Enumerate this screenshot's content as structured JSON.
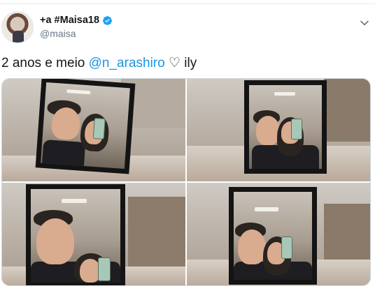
{
  "tweet": {
    "display_name": "+a #Maisa18",
    "handle": "@maisa",
    "verified": true,
    "text_before": "2 anos e meio ",
    "mention": "@n_arashiro",
    "text_after": " ♡ ily",
    "photo_count": 4
  },
  "icons": {
    "avatar": "profile-photo",
    "verified": "verified-badge-icon",
    "menu": "chevron-down-icon"
  },
  "colors": {
    "link": "#1b95e0",
    "text": "#14171a",
    "secondary": "#657786",
    "verified": "#1da1f2"
  }
}
